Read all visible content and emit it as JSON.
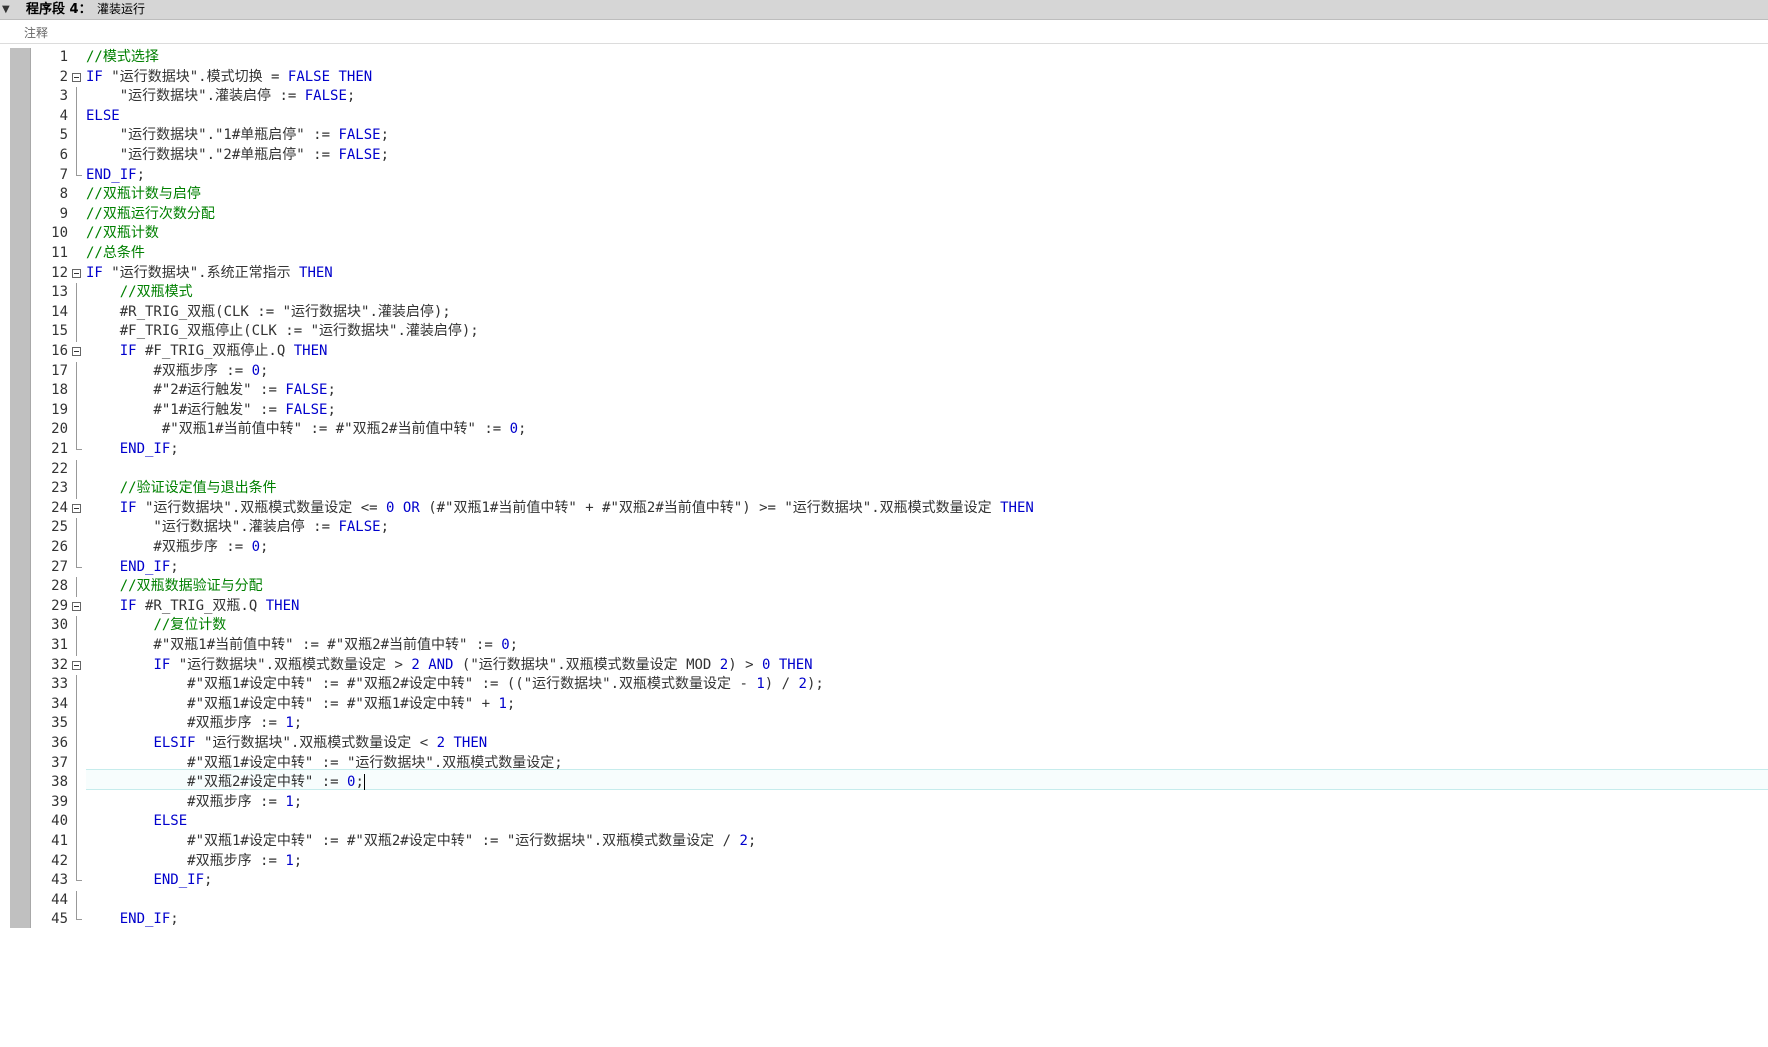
{
  "segment": {
    "label": "程序段 4：",
    "name": "灌装运行"
  },
  "comment_label": "注释",
  "colors": {
    "keyword": "#0000cc",
    "number": "#0000cc",
    "comment": "#008000",
    "plain": "#333333",
    "header_bg": "#d6d6d6",
    "current_line_border": "#c6ecec"
  },
  "cursor_line": 38,
  "lines": [
    {
      "n": "1",
      "fold": "",
      "segs": [
        [
          "c",
          "//模式选择"
        ]
      ]
    },
    {
      "n": "2",
      "fold": "box",
      "segs": [
        [
          "k",
          "IF"
        ],
        [
          "p",
          " \"运行数据块\".模式切换 "
        ],
        [
          "o",
          "="
        ],
        [
          "p",
          " "
        ],
        [
          "k",
          "FALSE"
        ],
        [
          "p",
          " "
        ],
        [
          "k",
          "THEN"
        ]
      ]
    },
    {
      "n": "3",
      "fold": "line",
      "segs": [
        [
          "p",
          "    \"运行数据块\".灌装启停 "
        ],
        [
          "o",
          ":="
        ],
        [
          "p",
          " "
        ],
        [
          "k",
          "FALSE"
        ],
        [
          "p",
          ";"
        ]
      ]
    },
    {
      "n": "4",
      "fold": "line",
      "segs": [
        [
          "k",
          "ELSE"
        ]
      ]
    },
    {
      "n": "5",
      "fold": "line",
      "segs": [
        [
          "p",
          "    \"运行数据块\".\"1#单瓶启停\" "
        ],
        [
          "o",
          ":="
        ],
        [
          "p",
          " "
        ],
        [
          "k",
          "FALSE"
        ],
        [
          "p",
          ";"
        ]
      ]
    },
    {
      "n": "6",
      "fold": "line",
      "segs": [
        [
          "p",
          "    \"运行数据块\".\"2#单瓶启停\" "
        ],
        [
          "o",
          ":="
        ],
        [
          "p",
          " "
        ],
        [
          "k",
          "FALSE"
        ],
        [
          "p",
          ";"
        ]
      ]
    },
    {
      "n": "7",
      "fold": "end",
      "segs": [
        [
          "k",
          "END_IF"
        ],
        [
          "p",
          ";"
        ]
      ]
    },
    {
      "n": "8",
      "fold": "",
      "segs": [
        [
          "c",
          "//双瓶计数与启停"
        ]
      ]
    },
    {
      "n": "9",
      "fold": "",
      "segs": [
        [
          "c",
          "//双瓶运行次数分配"
        ]
      ]
    },
    {
      "n": "10",
      "fold": "",
      "segs": [
        [
          "c",
          "//双瓶计数"
        ]
      ]
    },
    {
      "n": "11",
      "fold": "",
      "segs": [
        [
          "c",
          "//总条件"
        ]
      ]
    },
    {
      "n": "12",
      "fold": "box",
      "segs": [
        [
          "k",
          "IF"
        ],
        [
          "p",
          " \"运行数据块\".系统正常指示 "
        ],
        [
          "k",
          "THEN"
        ]
      ]
    },
    {
      "n": "13",
      "fold": "line",
      "segs": [
        [
          "p",
          "    "
        ],
        [
          "c",
          "//双瓶模式"
        ]
      ]
    },
    {
      "n": "14",
      "fold": "line",
      "segs": [
        [
          "p",
          "    #R_TRIG_双瓶(CLK "
        ],
        [
          "o",
          ":="
        ],
        [
          "p",
          " \"运行数据块\".灌装启停);"
        ]
      ]
    },
    {
      "n": "15",
      "fold": "line",
      "segs": [
        [
          "p",
          "    #F_TRIG_双瓶停止(CLK "
        ],
        [
          "o",
          ":="
        ],
        [
          "p",
          " \"运行数据块\".灌装启停);"
        ]
      ]
    },
    {
      "n": "16",
      "fold": "box",
      "segs": [
        [
          "p",
          "    "
        ],
        [
          "k",
          "IF"
        ],
        [
          "p",
          " #F_TRIG_双瓶停止.Q "
        ],
        [
          "k",
          "THEN"
        ]
      ]
    },
    {
      "n": "17",
      "fold": "line",
      "segs": [
        [
          "p",
          "        #双瓶步序 "
        ],
        [
          "o",
          ":="
        ],
        [
          "p",
          " "
        ],
        [
          "n",
          "0"
        ],
        [
          "p",
          ";"
        ]
      ]
    },
    {
      "n": "18",
      "fold": "line",
      "segs": [
        [
          "p",
          "        #\"2#运行触发\" "
        ],
        [
          "o",
          ":="
        ],
        [
          "p",
          " "
        ],
        [
          "k",
          "FALSE"
        ],
        [
          "p",
          ";"
        ]
      ]
    },
    {
      "n": "19",
      "fold": "line",
      "segs": [
        [
          "p",
          "        #\"1#运行触发\" "
        ],
        [
          "o",
          ":="
        ],
        [
          "p",
          " "
        ],
        [
          "k",
          "FALSE"
        ],
        [
          "p",
          ";"
        ]
      ]
    },
    {
      "n": "20",
      "fold": "line",
      "segs": [
        [
          "p",
          "         #\"双瓶1#当前值中转\" "
        ],
        [
          "o",
          ":="
        ],
        [
          "p",
          " #\"双瓶2#当前值中转\" "
        ],
        [
          "o",
          ":="
        ],
        [
          "p",
          " "
        ],
        [
          "n",
          "0"
        ],
        [
          "p",
          ";"
        ]
      ]
    },
    {
      "n": "21",
      "fold": "end",
      "segs": [
        [
          "p",
          "    "
        ],
        [
          "k",
          "END_IF"
        ],
        [
          "p",
          ";"
        ]
      ]
    },
    {
      "n": "22",
      "fold": "line",
      "segs": []
    },
    {
      "n": "23",
      "fold": "line",
      "segs": [
        [
          "p",
          "    "
        ],
        [
          "c",
          "//验证设定值与退出条件"
        ]
      ]
    },
    {
      "n": "24",
      "fold": "box",
      "segs": [
        [
          "p",
          "    "
        ],
        [
          "k",
          "IF"
        ],
        [
          "p",
          " \"运行数据块\".双瓶模式数量设定 "
        ],
        [
          "o",
          "<="
        ],
        [
          "p",
          " "
        ],
        [
          "n",
          "0"
        ],
        [
          "p",
          " "
        ],
        [
          "k",
          "OR"
        ],
        [
          "p",
          " (#\"双瓶1#当前值中转\" "
        ],
        [
          "o",
          "+"
        ],
        [
          "p",
          " #\"双瓶2#当前值中转\") "
        ],
        [
          "o",
          ">="
        ],
        [
          "p",
          " \"运行数据块\".双瓶模式数量设定 "
        ],
        [
          "k",
          "THEN"
        ]
      ]
    },
    {
      "n": "25",
      "fold": "line",
      "segs": [
        [
          "p",
          "        \"运行数据块\".灌装启停 "
        ],
        [
          "o",
          ":="
        ],
        [
          "p",
          " "
        ],
        [
          "k",
          "FALSE"
        ],
        [
          "p",
          ";"
        ]
      ]
    },
    {
      "n": "26",
      "fold": "line",
      "segs": [
        [
          "p",
          "        #双瓶步序 "
        ],
        [
          "o",
          ":="
        ],
        [
          "p",
          " "
        ],
        [
          "n",
          "0"
        ],
        [
          "p",
          ";"
        ]
      ]
    },
    {
      "n": "27",
      "fold": "end",
      "segs": [
        [
          "p",
          "    "
        ],
        [
          "k",
          "END_IF"
        ],
        [
          "p",
          ";"
        ]
      ]
    },
    {
      "n": "28",
      "fold": "line",
      "segs": [
        [
          "p",
          "    "
        ],
        [
          "c",
          "//双瓶数据验证与分配"
        ]
      ]
    },
    {
      "n": "29",
      "fold": "box",
      "segs": [
        [
          "p",
          "    "
        ],
        [
          "k",
          "IF"
        ],
        [
          "p",
          " #R_TRIG_双瓶.Q "
        ],
        [
          "k",
          "THEN"
        ]
      ]
    },
    {
      "n": "30",
      "fold": "line",
      "segs": [
        [
          "p",
          "        "
        ],
        [
          "c",
          "//复位计数"
        ]
      ]
    },
    {
      "n": "31",
      "fold": "line",
      "segs": [
        [
          "p",
          "        #\"双瓶1#当前值中转\" "
        ],
        [
          "o",
          ":="
        ],
        [
          "p",
          " #\"双瓶2#当前值中转\" "
        ],
        [
          "o",
          ":="
        ],
        [
          "p",
          " "
        ],
        [
          "n",
          "0"
        ],
        [
          "p",
          ";"
        ]
      ]
    },
    {
      "n": "32",
      "fold": "box",
      "segs": [
        [
          "p",
          "        "
        ],
        [
          "k",
          "IF"
        ],
        [
          "p",
          " \"运行数据块\".双瓶模式数量设定 "
        ],
        [
          "o",
          ">"
        ],
        [
          "p",
          " "
        ],
        [
          "n",
          "2"
        ],
        [
          "p",
          " "
        ],
        [
          "k",
          "AND"
        ],
        [
          "p",
          " (\"运行数据块\".双瓶模式数量设定 MOD "
        ],
        [
          "n",
          "2"
        ],
        [
          "p",
          ") "
        ],
        [
          "o",
          ">"
        ],
        [
          "p",
          " "
        ],
        [
          "n",
          "0"
        ],
        [
          "p",
          " "
        ],
        [
          "k",
          "THEN"
        ]
      ]
    },
    {
      "n": "33",
      "fold": "line",
      "segs": [
        [
          "p",
          "            #\"双瓶1#设定中转\" "
        ],
        [
          "o",
          ":="
        ],
        [
          "p",
          " #\"双瓶2#设定中转\" "
        ],
        [
          "o",
          ":="
        ],
        [
          "p",
          " ((\"运行数据块\".双瓶模式数量设定 "
        ],
        [
          "o",
          "-"
        ],
        [
          "p",
          " "
        ],
        [
          "n",
          "1"
        ],
        [
          "p",
          ") "
        ],
        [
          "o",
          "/"
        ],
        [
          "p",
          " "
        ],
        [
          "n",
          "2"
        ],
        [
          "p",
          ");"
        ]
      ]
    },
    {
      "n": "34",
      "fold": "line",
      "segs": [
        [
          "p",
          "            #\"双瓶1#设定中转\" "
        ],
        [
          "o",
          ":="
        ],
        [
          "p",
          " #\"双瓶1#设定中转\" "
        ],
        [
          "o",
          "+"
        ],
        [
          "p",
          " "
        ],
        [
          "n",
          "1"
        ],
        [
          "p",
          ";"
        ]
      ]
    },
    {
      "n": "35",
      "fold": "line",
      "segs": [
        [
          "p",
          "            #双瓶步序 "
        ],
        [
          "o",
          ":="
        ],
        [
          "p",
          " "
        ],
        [
          "n",
          "1"
        ],
        [
          "p",
          ";"
        ]
      ]
    },
    {
      "n": "36",
      "fold": "line",
      "segs": [
        [
          "p",
          "        "
        ],
        [
          "k",
          "ELSIF"
        ],
        [
          "p",
          " \"运行数据块\".双瓶模式数量设定 "
        ],
        [
          "o",
          "<"
        ],
        [
          "p",
          " "
        ],
        [
          "n",
          "2"
        ],
        [
          "p",
          " "
        ],
        [
          "k",
          "THEN"
        ]
      ]
    },
    {
      "n": "37",
      "fold": "line",
      "segs": [
        [
          "p",
          "            #\"双瓶1#设定中转\" "
        ],
        [
          "o",
          ":="
        ],
        [
          "p",
          " \"运行数据块\".双瓶模式数量设定;"
        ]
      ]
    },
    {
      "n": "38",
      "fold": "line",
      "segs": [
        [
          "p",
          "            #\"双瓶2#设定中转\" "
        ],
        [
          "o",
          ":="
        ],
        [
          "p",
          " "
        ],
        [
          "n",
          "0"
        ],
        [
          "p",
          ";"
        ]
      ]
    },
    {
      "n": "39",
      "fold": "line",
      "segs": [
        [
          "p",
          "            #双瓶步序 "
        ],
        [
          "o",
          ":="
        ],
        [
          "p",
          " "
        ],
        [
          "n",
          "1"
        ],
        [
          "p",
          ";"
        ]
      ]
    },
    {
      "n": "40",
      "fold": "line",
      "segs": [
        [
          "p",
          "        "
        ],
        [
          "k",
          "ELSE"
        ]
      ]
    },
    {
      "n": "41",
      "fold": "line",
      "segs": [
        [
          "p",
          "            #\"双瓶1#设定中转\" "
        ],
        [
          "o",
          ":="
        ],
        [
          "p",
          " #\"双瓶2#设定中转\" "
        ],
        [
          "o",
          ":="
        ],
        [
          "p",
          " \"运行数据块\".双瓶模式数量设定 "
        ],
        [
          "o",
          "/"
        ],
        [
          "p",
          " "
        ],
        [
          "n",
          "2"
        ],
        [
          "p",
          ";"
        ]
      ]
    },
    {
      "n": "42",
      "fold": "line",
      "segs": [
        [
          "p",
          "            #双瓶步序 "
        ],
        [
          "o",
          ":="
        ],
        [
          "p",
          " "
        ],
        [
          "n",
          "1"
        ],
        [
          "p",
          ";"
        ]
      ]
    },
    {
      "n": "43",
      "fold": "end",
      "segs": [
        [
          "p",
          "        "
        ],
        [
          "k",
          "END_IF"
        ],
        [
          "p",
          ";"
        ]
      ]
    },
    {
      "n": "44",
      "fold": "line",
      "segs": []
    },
    {
      "n": "45",
      "fold": "end",
      "segs": [
        [
          "p",
          "    "
        ],
        [
          "k",
          "END_IF"
        ],
        [
          "p",
          ";"
        ]
      ]
    }
  ]
}
